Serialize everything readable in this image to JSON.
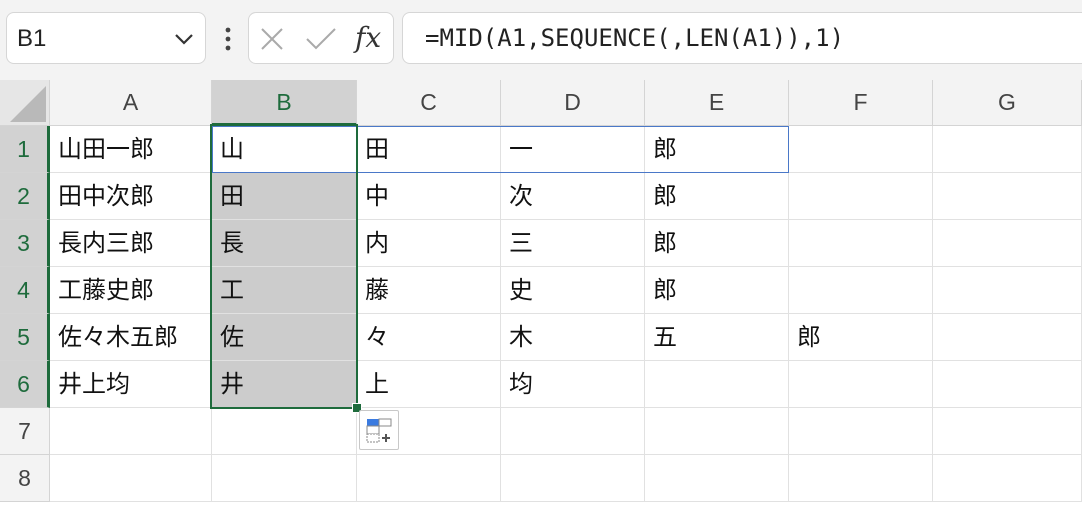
{
  "namebox": {
    "value": "B1"
  },
  "formula_bar": {
    "formula": "=MID(A1,SEQUENCE(,LEN(A1)),1)"
  },
  "columns": [
    "A",
    "B",
    "C",
    "D",
    "E",
    "F",
    "G"
  ],
  "rows": [
    "1",
    "2",
    "3",
    "4",
    "5",
    "6",
    "7",
    "8"
  ],
  "cells": {
    "r1": [
      "山田一郎",
      "山",
      "田",
      "一",
      "郎",
      "",
      ""
    ],
    "r2": [
      "田中次郎",
      "田",
      "中",
      "次",
      "郎",
      "",
      ""
    ],
    "r3": [
      "長内三郎",
      "長",
      "内",
      "三",
      "郎",
      "",
      ""
    ],
    "r4": [
      "工藤史郎",
      "工",
      "藤",
      "史",
      "郎",
      "",
      ""
    ],
    "r5": [
      "佐々木五郎",
      "佐",
      "々",
      "木",
      "五",
      "郎",
      ""
    ],
    "r6": [
      "井上均",
      "井",
      "上",
      "均",
      "",
      "",
      ""
    ],
    "r7": [
      "",
      "",
      "",
      "",
      "",
      "",
      ""
    ],
    "r8": [
      "",
      "",
      "",
      "",
      "",
      "",
      ""
    ]
  },
  "selection": {
    "range": "B1:B6",
    "active_cell": "B1"
  },
  "icons": {
    "dropdown": "chevron-down-icon",
    "more": "vertical-dots-icon",
    "cancel": "close-icon",
    "enter": "checkmark-icon",
    "function": "fx-icon",
    "quick_analysis": "quick-analysis-icon"
  },
  "colors": {
    "selection_border": "#1e6b3c",
    "spill_border": "#4a78c8",
    "selected_fill": "#cccccc"
  }
}
